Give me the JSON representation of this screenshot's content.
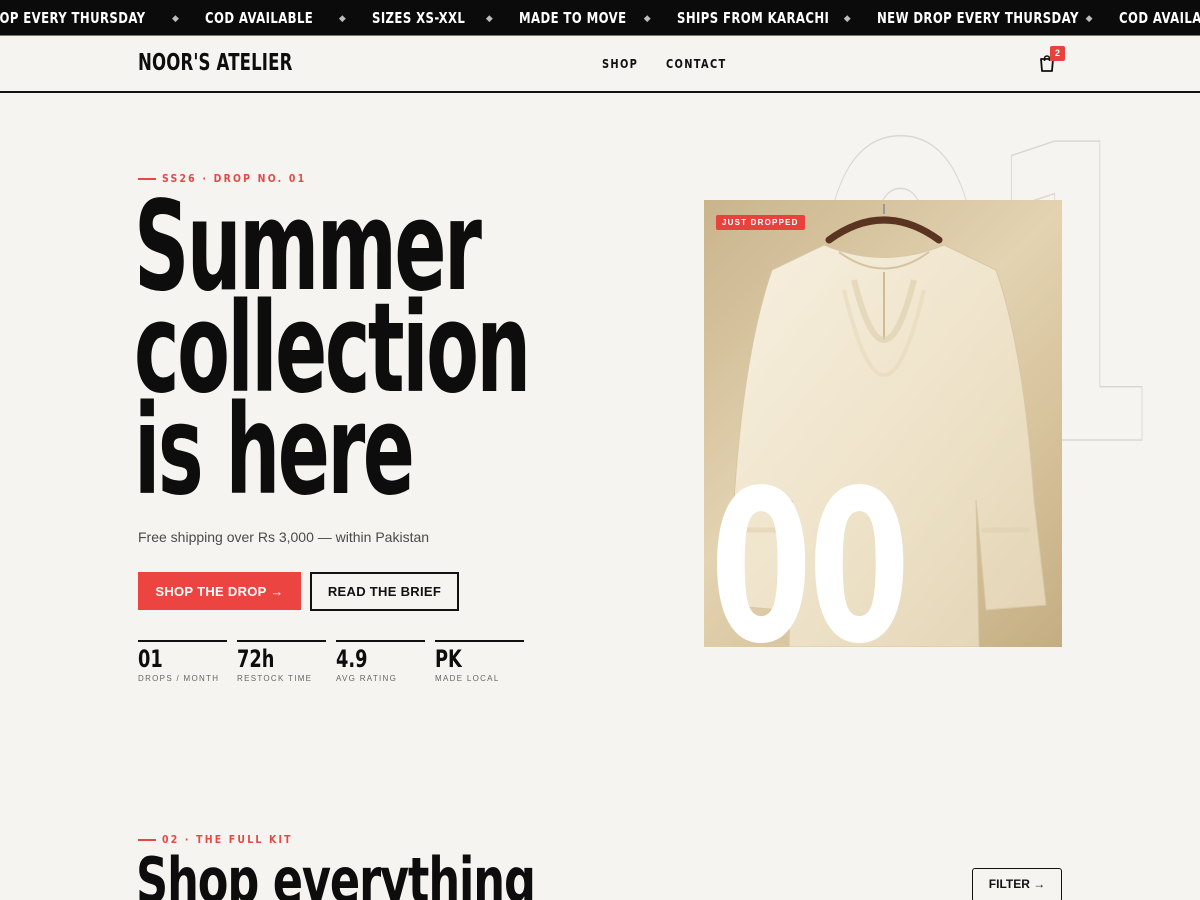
{
  "ticker": {
    "items": [
      "DROP EVERY THURSDAY",
      "COD AVAILABLE",
      "SIZES XS-XXL",
      "MADE TO MOVE",
      "SHIPS FROM KARACHI",
      "NEW DROP EVERY THURSDAY",
      "COD AVAILABLE"
    ],
    "separator": "◆"
  },
  "header": {
    "brand": "NOOR'S ATELIER",
    "nav": [
      "SHOP",
      "CONTACT"
    ],
    "cart_count": "2"
  },
  "hero": {
    "eyebrow": "SS26 · DROP NO. 01",
    "headline": [
      "Summer",
      "collection",
      "is here"
    ],
    "subline": "Free shipping over Rs 3,000 — within Pakistan",
    "primary_cta": "SHOP THE DROP →",
    "secondary_cta": "READ THE BRIEF",
    "stats": [
      {
        "value": "01",
        "label": "DROPS / MONTH"
      },
      {
        "value": "72h",
        "label": "RESTOCK TIME"
      },
      {
        "value": "4.9",
        "label": "AVG RATING"
      },
      {
        "value": "PK",
        "label": "MADE LOCAL"
      }
    ],
    "bg_number": "01",
    "product_badge": "JUST DROPPED",
    "product_counter": "00"
  },
  "section2": {
    "eyebrow": "02 · THE FULL KIT",
    "title": "Shop everything",
    "filter_label": "FILTER →"
  },
  "colors": {
    "accent": "#ec4541",
    "ink": "#0d0d0d",
    "background": "#f6f4f0",
    "ticker_bg": "#0b0b0b"
  },
  "icons": {
    "cart": "shopping-bag-icon",
    "separator": "diamond-icon"
  }
}
